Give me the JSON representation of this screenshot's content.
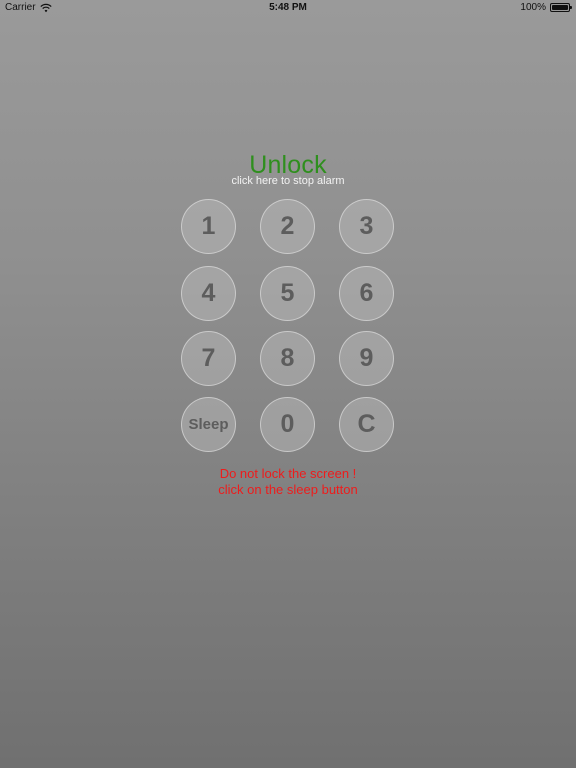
{
  "status_bar": {
    "carrier": "Carrier",
    "time": "5:48 PM",
    "battery": "100%"
  },
  "unlock": {
    "title": "Unlock",
    "subtitle": "click here to stop alarm",
    "title_color": "#2f8f1e"
  },
  "keypad": {
    "keys": [
      "1",
      "2",
      "3",
      "4",
      "5",
      "6",
      "7",
      "8",
      "9",
      "Sleep",
      "0",
      "C"
    ]
  },
  "warning": {
    "line1": "Do not lock the screen !",
    "line2": "click on the sleep button",
    "color": "#ee1c1c"
  },
  "icons": {
    "wifi": "wifi-icon",
    "battery": "battery-icon"
  }
}
